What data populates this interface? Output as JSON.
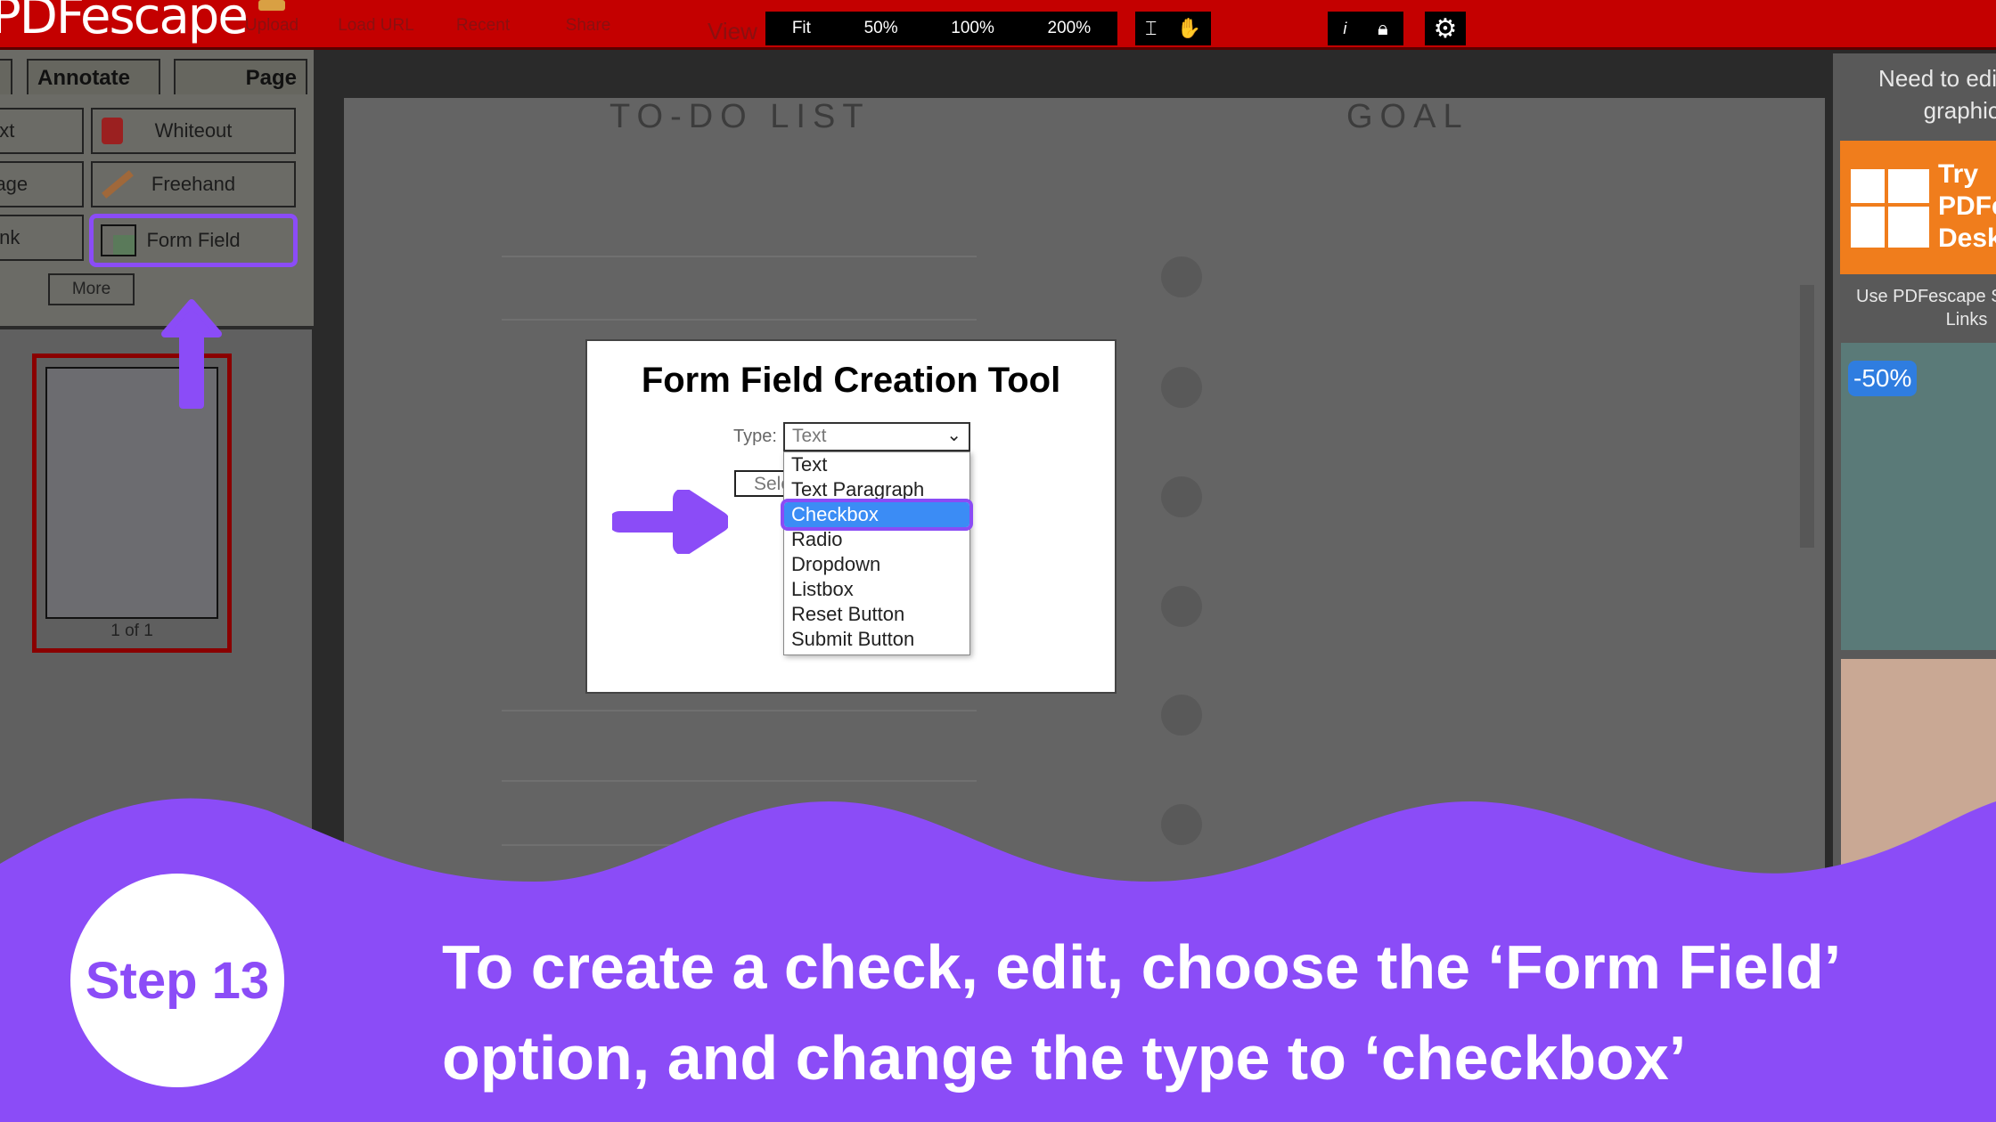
{
  "app": {
    "logo": "PDFescape"
  },
  "toolbar": {
    "items": [
      "Upload",
      "Load URL",
      "Recent",
      "Share"
    ],
    "view_label": "View",
    "zoom": [
      "Fit",
      "50%",
      "100%",
      "200%"
    ],
    "info": "i"
  },
  "tabs": [
    "Annotate",
    "Page"
  ],
  "tools": {
    "left": [
      "Text",
      "Image",
      "Link"
    ],
    "right": [
      "Whiteout",
      "Freehand",
      "Form Field"
    ],
    "more": "More"
  },
  "thumbnail": {
    "label": "1 of 1"
  },
  "document": {
    "headers": [
      "TO-DO LIST",
      "GOAL"
    ]
  },
  "dialog": {
    "title": "Form Field Creation Tool",
    "type_label": "Type:",
    "type_value": "Text",
    "select_button": "Select",
    "options": [
      "Text",
      "Text Paragraph",
      "Checkbox",
      "Radio",
      "Dropdown",
      "Listbox",
      "Reset Button",
      "Submit Button"
    ],
    "selected": "Checkbox"
  },
  "ad": {
    "headline": "Need to edit text & graphics?",
    "cta": "Try PDFescape Desktop",
    "sub": "Use PDFescape Sponsored Links",
    "discount": "-50%"
  },
  "overlay": {
    "step": "Step 13",
    "caption_line1": "To create a check, edit, choose the ‘Form Field’",
    "caption_line2": "option, and change the type to ‘checkbox’",
    "accent": "#8b4cf7"
  }
}
